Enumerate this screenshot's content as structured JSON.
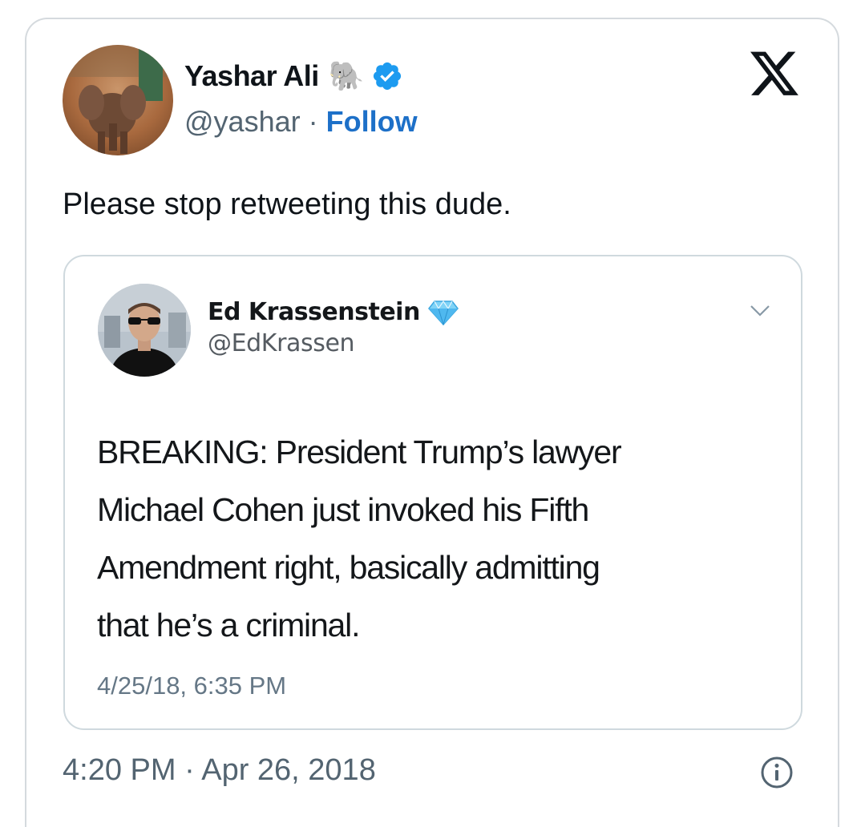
{
  "author": {
    "name": "Yashar Ali",
    "emoji": "🐘",
    "handle": "@yashar",
    "separator": "·",
    "follow_label": "Follow"
  },
  "tweet": {
    "text": "Please stop retweeting this dude.",
    "time": "4:20 PM",
    "date_separator": "·",
    "date": "Apr 26, 2018"
  },
  "quoted": {
    "name": "Ed Krassenstein",
    "handle": "@EdKrassen",
    "lines": [
      "BREAKING: President Trump’s lawyer",
      "Michael Cohen just invoked his Fifth",
      "Amendment right, basically admitting",
      "that he’s a criminal."
    ],
    "timestamp": "4/25/18, 6:35 PM"
  },
  "icons": {
    "verified": "verified-badge-icon",
    "logo": "x-logo-icon",
    "gem": "diamond-icon",
    "chevron": "chevron-down-icon",
    "info": "info-icon"
  },
  "colors": {
    "accent": "#1d70c8",
    "verified": "#1d9bf0",
    "muted": "#536471",
    "border": "#cfd9de"
  }
}
